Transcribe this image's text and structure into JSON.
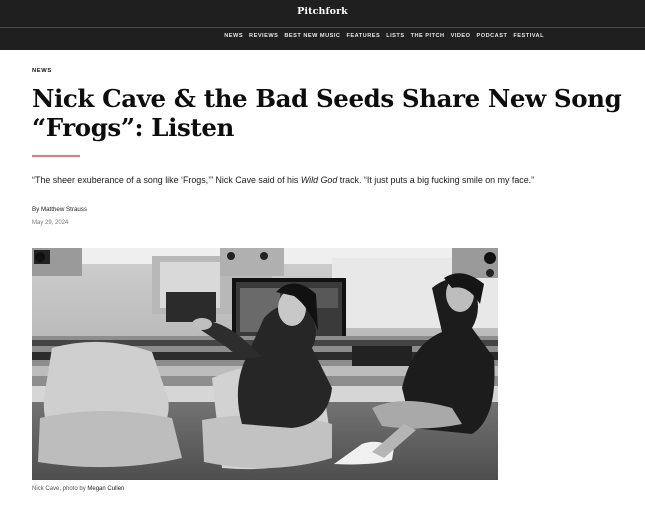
{
  "site": {
    "logo": "Pitchfork"
  },
  "nav": [
    "NEWS",
    "REVIEWS",
    "BEST NEW MUSIC",
    "FEATURES",
    "LISTS",
    "THE PITCH",
    "VIDEO",
    "PODCAST",
    "FESTIVAL"
  ],
  "article": {
    "section": "NEWS",
    "headline": "Nick Cave & the Bad Seeds Share New Song “Frogs”: Listen",
    "dek_before": "“The sheer exuberance of a song like ‘Frogs,’” Nick Cave said of his ",
    "dek_italic": "Wild God",
    "dek_after": " track. “It just puts a big fucking smile on my face.”",
    "byline_prefix": "By ",
    "author": "Matthew Strauss",
    "date": "May 29, 2024"
  },
  "photo": {
    "caption_prefix": "Nick Cave, photo by ",
    "photographer": "Megan Cullen"
  },
  "colors": {
    "topbar": "#1f1f1f",
    "accent_rule": "#e3797a"
  }
}
